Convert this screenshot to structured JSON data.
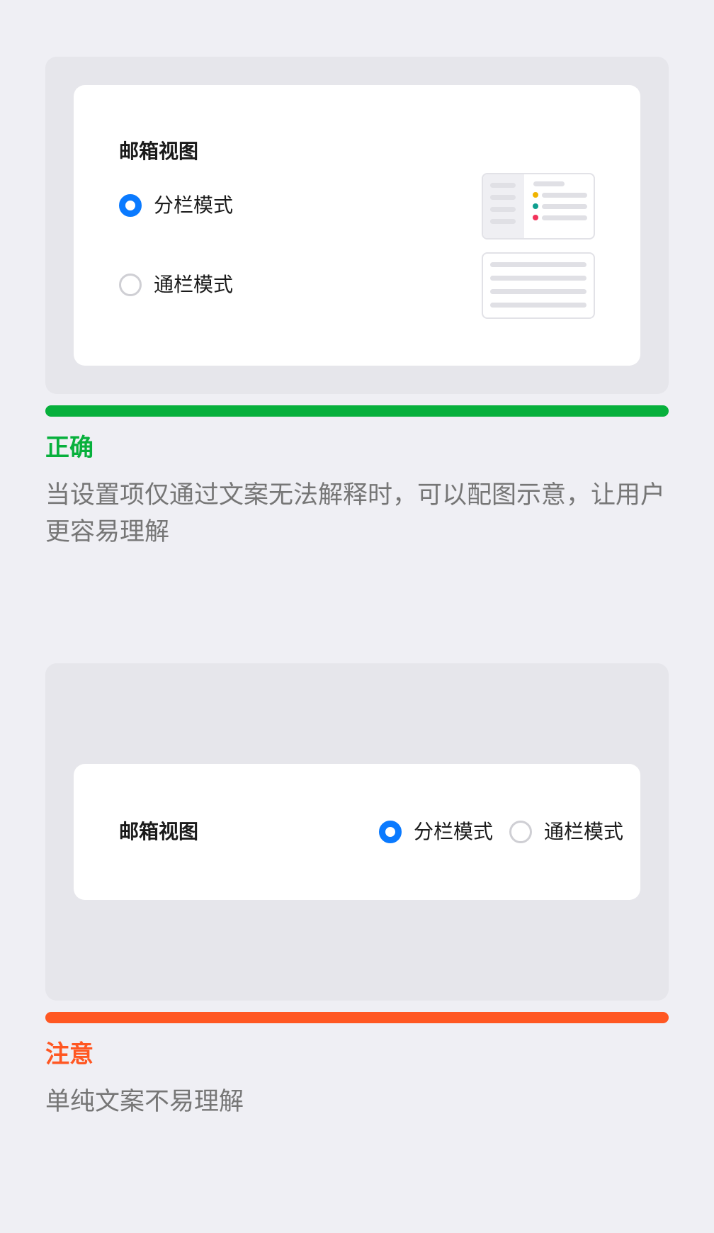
{
  "colors": {
    "page_background": "#EFEFF4",
    "preview_background": "#E6E6EB",
    "radio_selected": "#0A7AFF",
    "radio_unselected_border": "#CFCFD4",
    "correct": "#07B03C",
    "caution": "#FF5722",
    "description_text": "#767676",
    "thumb_dot_yellow": "#F0B400",
    "thumb_dot_teal": "#0F9F8F",
    "thumb_dot_pink": "#F2335B"
  },
  "correct_example": {
    "setting_title": "邮箱视图",
    "options": [
      {
        "label": "分栏模式",
        "selected": true,
        "thumbnail": "split-view-thumbnail"
      },
      {
        "label": "通栏模式",
        "selected": false,
        "thumbnail": "full-width-view-thumbnail"
      }
    ],
    "verdict": "正确",
    "description": "当设置项仅通过文案无法解释时，可以配图示意，让用户更容易理解"
  },
  "caution_example": {
    "setting_title": "邮箱视图",
    "options": [
      {
        "label": "分栏模式",
        "selected": true
      },
      {
        "label": "通栏模式",
        "selected": false
      }
    ],
    "verdict": "注意",
    "description": "单纯文案不易理解"
  }
}
